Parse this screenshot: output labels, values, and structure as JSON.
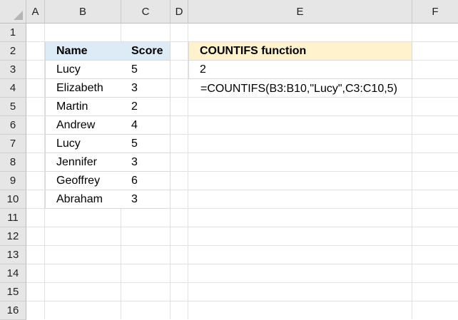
{
  "columns": [
    "A",
    "B",
    "C",
    "D",
    "E",
    "F"
  ],
  "rows": [
    "1",
    "2",
    "3",
    "4",
    "5",
    "6",
    "7",
    "8",
    "9",
    "10",
    "11",
    "12",
    "13",
    "14",
    "15",
    "16"
  ],
  "table": {
    "header_name": "Name",
    "header_score": "Score",
    "rows": [
      {
        "name": "Lucy",
        "score": "5"
      },
      {
        "name": "Elizabeth",
        "score": "3"
      },
      {
        "name": "Martin",
        "score": "2"
      },
      {
        "name": "Andrew",
        "score": "4"
      },
      {
        "name": "Lucy",
        "score": "5"
      },
      {
        "name": "Jennifer",
        "score": "3"
      },
      {
        "name": "Geoffrey",
        "score": "6"
      },
      {
        "name": "Abraham",
        "score": "3"
      }
    ]
  },
  "result_box": {
    "title": "COUNTIFS function",
    "value": "2",
    "formula": "=COUNTIFS(B3:B10,\"Lucy\",C3:C10,5)"
  },
  "colors": {
    "table_header_bg": "#ddebf7",
    "result_header_bg": "#fff2cc",
    "header_gray": "#e6e6e6"
  }
}
